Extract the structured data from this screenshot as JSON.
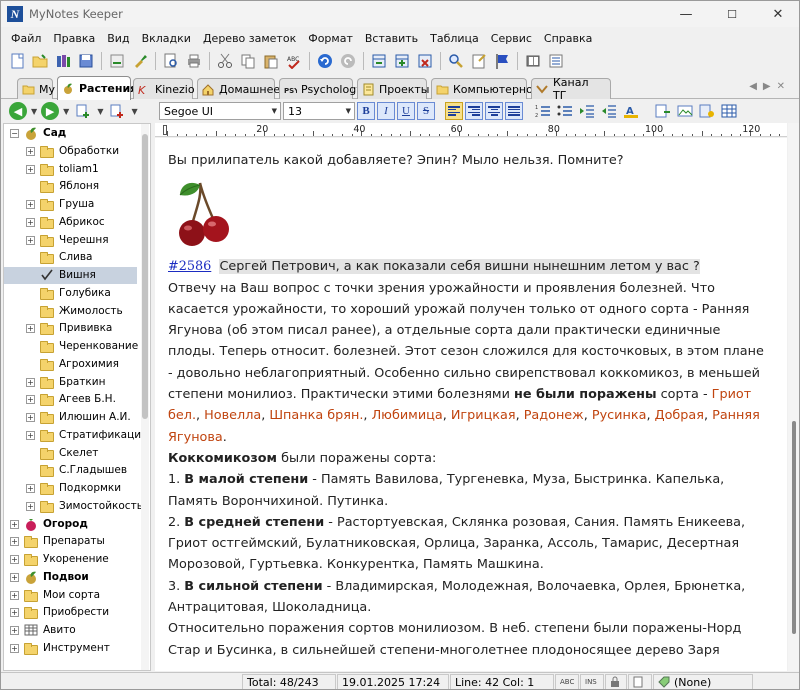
{
  "window": {
    "title": "MyNotes Keeper",
    "controls": [
      "minimize",
      "maximize",
      "close"
    ]
  },
  "menu": [
    "Файл",
    "Правка",
    "Вид",
    "Вкладки",
    "Дерево заметок",
    "Формат",
    "Вставить",
    "Таблица",
    "Сервис",
    "Справка"
  ],
  "toolbar_icons": [
    "new-document-icon",
    "open-folder-icon",
    "books-icon",
    "save-icon",
    "save-as-icon",
    "brush-icon",
    "print-preview-icon",
    "print-icon",
    "cut-icon",
    "copy-icon",
    "paste-icon",
    "spellcheck-icon",
    "undo-icon",
    "redo-icon",
    "insert-note-icon",
    "move-note-icon",
    "delete-note-icon",
    "search-icon",
    "open-note-icon",
    "flag-icon",
    "book-icon",
    "properties-icon"
  ],
  "tabs": [
    {
      "label": "My",
      "icon": "folder-icon",
      "active": false
    },
    {
      "label": "Растения",
      "icon": "plant-icon",
      "active": true
    },
    {
      "label": "Kinezio",
      "icon": "kinezio-icon",
      "active": false
    },
    {
      "label": "Домашнее",
      "icon": "home-icon",
      "active": false
    },
    {
      "label": "Psychology",
      "icon": "psy-icon",
      "active": false
    },
    {
      "label": "Проекты",
      "icon": "notepad-icon",
      "active": false
    },
    {
      "label": "Компьютерное",
      "icon": "folder-icon",
      "active": false
    },
    {
      "label": "Канал ТГ",
      "icon": "chevron-icon",
      "active": false
    }
  ],
  "format": {
    "font": "Segoe UI",
    "size": "13",
    "bold": "B",
    "italic": "I",
    "underline": "U",
    "strike": "S"
  },
  "ruler": {
    "labels": [
      "20",
      "40",
      "60",
      "80",
      "100",
      "120",
      "140",
      "160",
      "180"
    ]
  },
  "tree": [
    {
      "label": "Сад",
      "level": 0,
      "bold": true,
      "expanded": true,
      "icon": "plant-icon"
    },
    {
      "label": "Обработки",
      "level": 1,
      "expander": true
    },
    {
      "label": "toliam1",
      "level": 1,
      "expander": true
    },
    {
      "label": "Яблоня",
      "level": 1
    },
    {
      "label": "Груша",
      "level": 1,
      "expander": true
    },
    {
      "label": "Абрикос",
      "level": 1,
      "expander": true
    },
    {
      "label": "Черешня",
      "level": 1,
      "expander": true
    },
    {
      "label": "Слива",
      "level": 1
    },
    {
      "label": "Вишня",
      "level": 1,
      "selected": true,
      "icon": "checked-note-icon"
    },
    {
      "label": "Голубика",
      "level": 1
    },
    {
      "label": "Жимолость",
      "level": 1
    },
    {
      "label": "Прививка",
      "level": 1,
      "expander": true
    },
    {
      "label": "Черенкование",
      "level": 1
    },
    {
      "label": "Агрохимия",
      "level": 1
    },
    {
      "label": "Браткин",
      "level": 1,
      "expander": true
    },
    {
      "label": "Агеев Б.Н.",
      "level": 1,
      "expander": true
    },
    {
      "label": "Илюшин А.И.",
      "level": 1,
      "expander": true
    },
    {
      "label": "Стратификация",
      "level": 1,
      "expander": true
    },
    {
      "label": "Скелет",
      "level": 1
    },
    {
      "label": "С.Гладышев",
      "level": 1
    },
    {
      "label": "Подкормки",
      "level": 1,
      "expander": true
    },
    {
      "label": "Зимостойкость",
      "level": 1,
      "expander": true
    },
    {
      "label": "Огород",
      "level": 0,
      "bold": true,
      "expander": true,
      "icon": "berry-icon"
    },
    {
      "label": "Препараты",
      "level": 0,
      "expander": true
    },
    {
      "label": "Укоренение",
      "level": 0,
      "expander": true
    },
    {
      "label": "Подвои",
      "level": 0,
      "bold": true,
      "expander": true,
      "icon": "plant-icon"
    },
    {
      "label": "Мои сорта",
      "level": 0,
      "expander": true
    },
    {
      "label": "Приобрести",
      "level": 0,
      "expander": true
    },
    {
      "label": "Авито",
      "level": 0,
      "expander": true,
      "icon": "grid-icon"
    },
    {
      "label": "Инструмент",
      "level": 0,
      "expander": true
    }
  ],
  "note": {
    "intro": "Вы прилипатель какой добавляете? Эпин? Мыло нельзя. Помните?",
    "image": "cherries-icon",
    "qnum": "#2586",
    "question": "Сергей Петрович, а как показали себя вишни нынешним летом у вас ?",
    "answer_start": "Отвечу на Ваш вопрос с точки зрения урожайности и проявления болезней. Что касается урожайности, то хороший урожай получен только от одного сорта - Ранняя Ягунова (об этом писал ранее), а отдельные сорта дали практически единичные плоды. Теперь относит. болезней. Этот сезон сложился для косточковых, в этом плане - довольно неблагоприятный. Особенно сильно свирепствовал коккомикоз, в меньшей степени монилиоз. Практически этими болезнями ",
    "answer_bold": "не были поражены",
    "answer_mid": " сорта - ",
    "unaffected": [
      "Гриот бел.",
      "Новелла",
      "Шпанка брян.",
      "Любимица",
      "Игрицкая",
      "Радонеж",
      "Русинка",
      "Добрая",
      "Ранняя Ягунова"
    ],
    "kokko_label": "Коккомикозом",
    "kokko_text": " были поражены сорта:",
    "items": [
      {
        "n": "1.",
        "degree": "В малой степени",
        "list": " - Память Вавилова, Тургеневка, Муза, Быстринка. Капелька, Память Ворончихиной. Путинка."
      },
      {
        "n": "2.",
        "degree": "В средней степени",
        "list": " - Растортуевская, Склянка розовая, Сания. Память Еникеева, Гриот остгеймский, Булатниковская, Орлица, Заранка, Ассоль, Тамарис, Десертная Морозовой, Гуртьевка. Конкурентка, Память Машкина."
      },
      {
        "n": "3.",
        "degree": "В сильной степени",
        "list": " - Владимирская, Молодежная, Волочаевка, Орлея, Брюнетка, Антрацитовая, Шоколадница."
      }
    ],
    "moni": "Относительно поражения сортов монилиозом. В неб. степени были поражены-Норд Стар и Бусинка, в сильнейшей степени-многолетнее плодоносящее дерево Заря"
  },
  "status": {
    "total": "Total: 48/243",
    "date": "19.01.2025 17:24",
    "pos": "Line: 42  Col: 1",
    "tag": "(None)"
  },
  "colors": {
    "link": "#1b2cc1",
    "variety": "#c0440f",
    "selection": "#c8d2df"
  }
}
